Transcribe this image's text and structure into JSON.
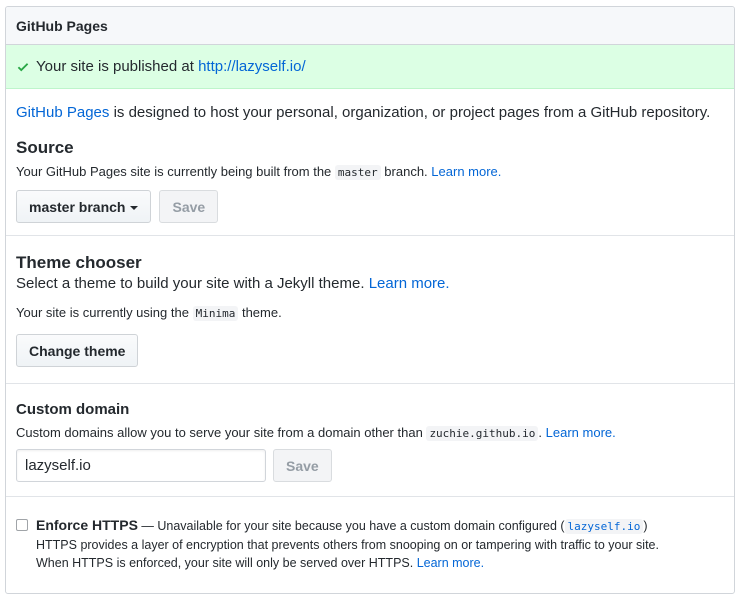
{
  "header": {
    "title": "GitHub Pages"
  },
  "flash": {
    "text": "Your site is published at",
    "url": "http://lazyself.io/",
    "icon": "check-icon",
    "color": "#dcffe4"
  },
  "intro": {
    "link_text": "GitHub Pages",
    "text": "is designed to host your personal, organization, or project pages from a GitHub repository."
  },
  "source": {
    "heading": "Source",
    "note_before": "Your GitHub Pages site is currently being built from the",
    "branch_code": "master",
    "note_after": "branch.",
    "learn_more": "Learn more.",
    "branch_button": "master branch",
    "save_button": "Save"
  },
  "theme": {
    "heading": "Theme chooser",
    "desc": "Select a theme to build your site with a Jekyll theme.",
    "learn_more": "Learn more.",
    "current_before": "Your site is currently using the",
    "theme_code": "Minima",
    "current_after": "theme.",
    "change_button": "Change theme"
  },
  "domain": {
    "heading": "Custom domain",
    "note_before": "Custom domains allow you to serve your site from a domain other than",
    "default_domain": "zuchie.github.io",
    "note_after": ".",
    "learn_more": "Learn more.",
    "input_value": "lazyself.io",
    "save_button": "Save"
  },
  "https": {
    "title": "Enforce HTTPS",
    "unavailable_before": "— Unavailable for your site because you have a custom domain configured (",
    "domain_code": "lazyself.io",
    "unavailable_after": ")",
    "line2": "HTTPS provides a layer of encryption that prevents others from snooping on or tampering with traffic to your site.",
    "line3": "When HTTPS is enforced, your site will only be served over HTTPS.",
    "learn_more": "Learn more.",
    "checked": false
  },
  "colors": {
    "link": "#0366d6",
    "success_bg": "#dcffe4",
    "border": "#d1d5da"
  }
}
